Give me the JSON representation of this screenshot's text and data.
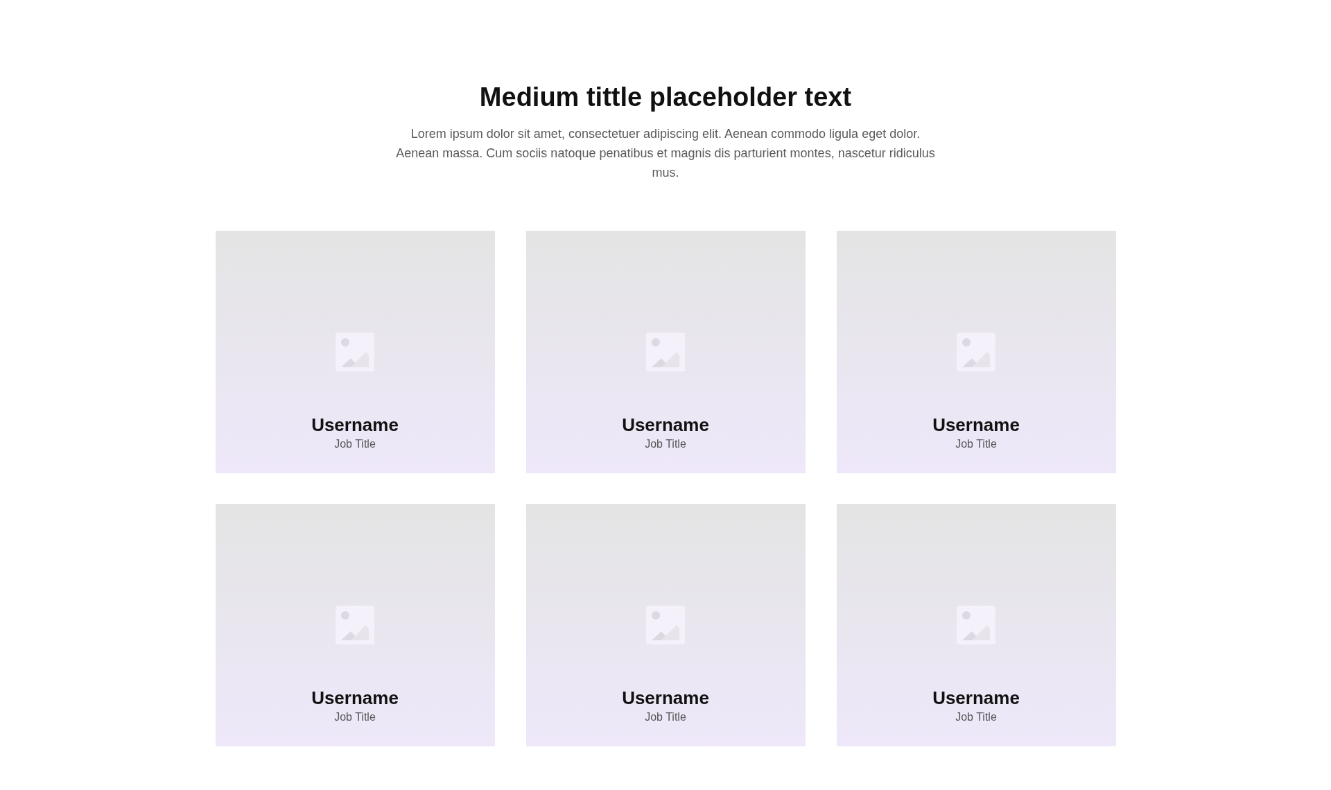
{
  "header": {
    "title": "Medium tittle placeholder text",
    "description": "Lorem ipsum dolor sit amet, consectetuer adipiscing elit. Aenean commodo ligula eget dolor. Aenean massa. Cum sociis natoque penatibus et magnis dis parturient montes, nascetur ridiculus mus."
  },
  "members": [
    {
      "name": "Username",
      "job_title": "Job Title"
    },
    {
      "name": "Username",
      "job_title": "Job Title"
    },
    {
      "name": "Username",
      "job_title": "Job Title"
    },
    {
      "name": "Username",
      "job_title": "Job Title"
    },
    {
      "name": "Username",
      "job_title": "Job Title"
    },
    {
      "name": "Username",
      "job_title": "Job Title"
    }
  ]
}
